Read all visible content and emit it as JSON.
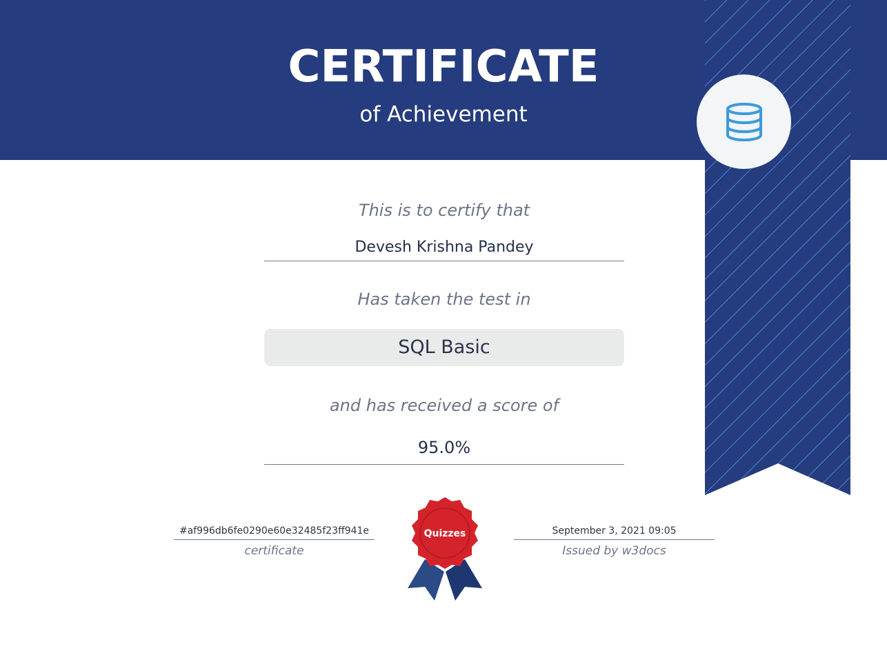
{
  "header": {
    "title": "CERTIFICATE",
    "subtitle": "of Achievement"
  },
  "emblem": {
    "icon": "database-icon",
    "color": "#3b9bdc"
  },
  "body": {
    "certify_text": "This is to certify that",
    "recipient_name": "Devesh Krishna Pandey",
    "test_intro": "Has taken the test in",
    "test_name": "SQL Basic",
    "score_intro": "and has received a score of",
    "score": "95.0%"
  },
  "footer": {
    "certificate_id": "#af996db6fe0290e60e32485f23ff941e",
    "certificate_label": "certificate",
    "issued_date": "September 3, 2021 09:05",
    "issued_label": "Issued by w3docs"
  },
  "badge": {
    "label": "Quizzes",
    "icon": "award-ribbon-icon",
    "color": "#d5232b"
  },
  "colors": {
    "header_bg": "#253c7e",
    "ribbon_stripe": "#4a86d4",
    "text_muted": "#6c7486",
    "text_dark": "#23304a"
  }
}
